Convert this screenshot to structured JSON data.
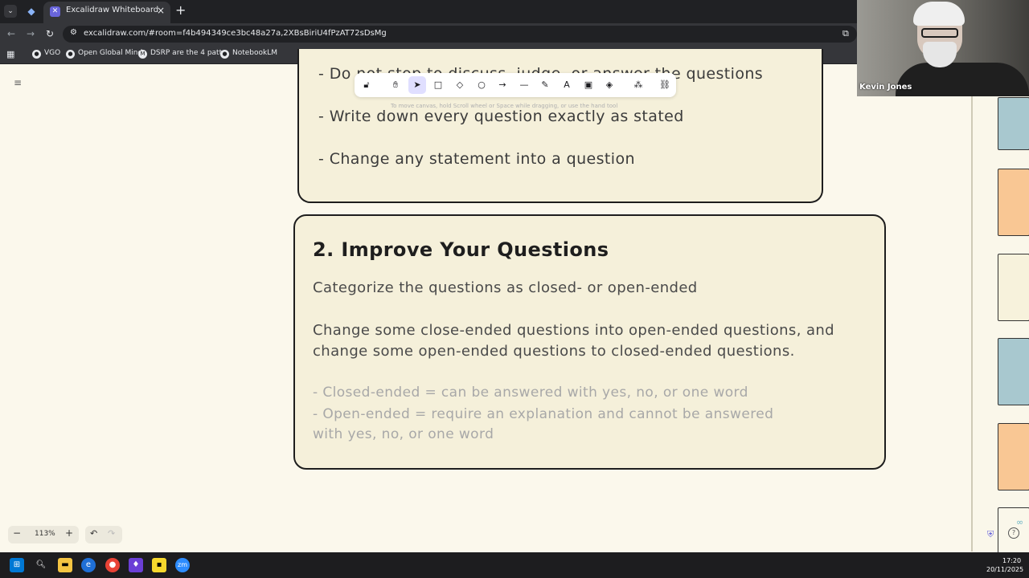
{
  "browser": {
    "tab_title": "Excalidraw Whiteboard",
    "url": "excalidraw.com/#room=f4b494349ce3bc48a27a,2XBsBiriU4fPzAT72sDsMg",
    "bookmarks": [
      {
        "label": "VGO",
        "icon": "globe-icon"
      },
      {
        "label": "Open Global Mind",
        "icon": "people-icon"
      },
      {
        "label": "DSRP are the 4 patt...",
        "icon": "m-icon"
      },
      {
        "label": "NotebookLM",
        "icon": "notebook-icon"
      }
    ]
  },
  "toolbar": {
    "tools": [
      "lock",
      "hand",
      "selection",
      "rectangle",
      "diamond",
      "ellipse",
      "arrow",
      "line",
      "draw",
      "text",
      "image",
      "eraser",
      "more-tools",
      "library"
    ],
    "active_tool": "selection",
    "hint": "To move canvas, hold Scroll wheel or Space while dragging, or use the hand tool"
  },
  "canvas": {
    "card1": {
      "lines": [
        "- Do not stop to discuss, judge, or answer the questions",
        "- Write down every question exactly as stated",
        "- Change any statement into a question"
      ]
    },
    "card2": {
      "title": "2. Improve Your Questions",
      "para1": "Categorize the questions as closed- or open-ended",
      "para2_line1": "Change some close-ended questions into open-ended questions, and",
      "para2_line2": "change some open-ended questions to closed-ended questions.",
      "faint1": "- Closed-ended = can be answered with yes, no, or one word",
      "faint2_line1": "- Open-ended = require an explanation and cannot be answered",
      "faint2_line2": "  with yes, no, or one word"
    }
  },
  "controls": {
    "zoom": "113%"
  },
  "video": {
    "participant_name": "Kevin Jones"
  },
  "taskbar": {
    "time": "17:20",
    "date": "20/11/2025"
  },
  "colors": {
    "canvas_bg": "#fbf8ec",
    "card_bg": "#f5f0da",
    "accent": "#6965db",
    "swatch_blue": "#a8c8cf",
    "swatch_orange": "#f9c794",
    "swatch_cream": "#f7f2dc"
  }
}
